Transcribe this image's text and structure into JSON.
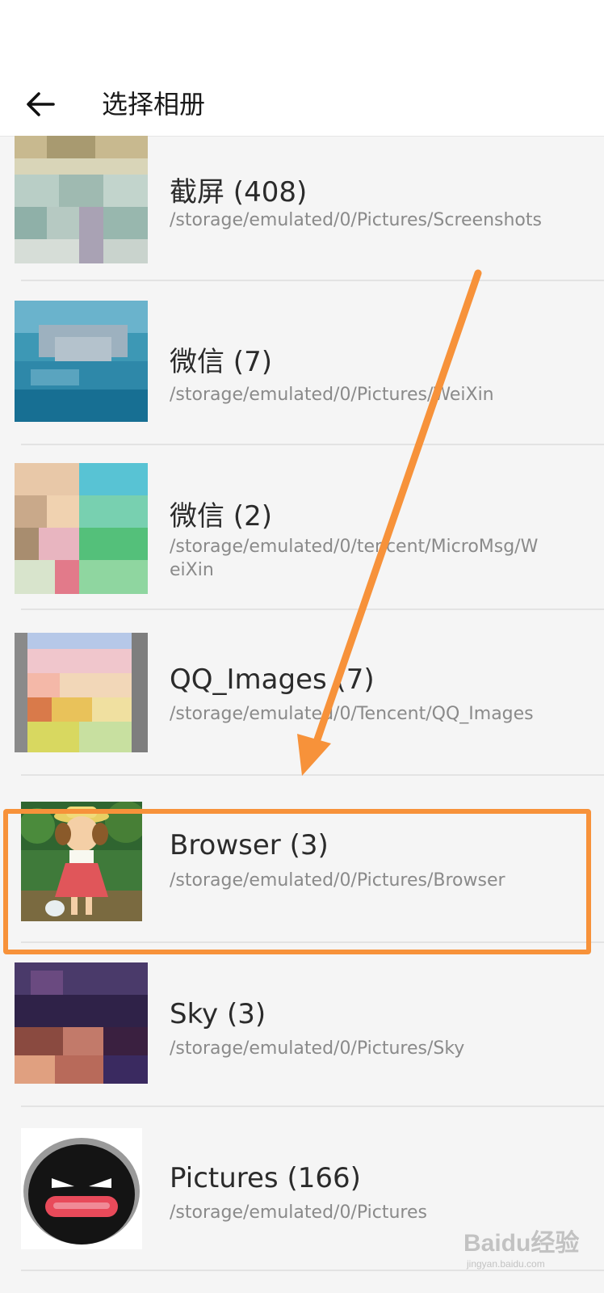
{
  "header": {
    "title": "选择相册",
    "back_icon": "arrow-back-icon"
  },
  "albums": [
    {
      "title": "截屏 (408)",
      "path": "/storage/emulated/0/Pictures/Screenshots"
    },
    {
      "title": "微信 (7)",
      "path": "/storage/emulated/0/Pictures/WeiXin"
    },
    {
      "title": "微信 (2)",
      "path": "/storage/emulated/0/tencent/MicroMsg/WeiXin"
    },
    {
      "title": "QQ_Images (7)",
      "path": "/storage/emulated/0/Tencent/QQ_Images"
    },
    {
      "title": "Browser (3)",
      "path": "/storage/emulated/0/Pictures/Browser"
    },
    {
      "title": "Sky (3)",
      "path": "/storage/emulated/0/Pictures/Sky"
    },
    {
      "title": "Pictures (166)",
      "path": "/storage/emulated/0/Pictures"
    }
  ],
  "annotation": {
    "highlighted_album": "Browser (3)",
    "color": "#f7923a"
  },
  "watermark": {
    "text": "Baidu经验",
    "subtext": "jingyan.baidu.com"
  }
}
